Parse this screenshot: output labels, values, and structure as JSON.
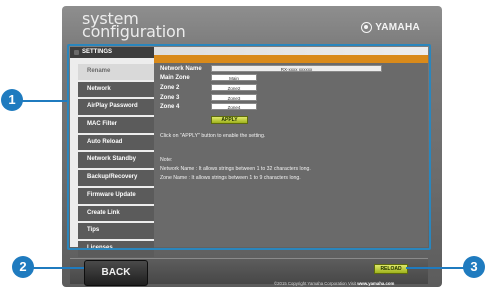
{
  "brand": {
    "title_line1": "system",
    "title_line2": "configuration",
    "logo_text": "YAMAHA"
  },
  "settings": {
    "tab_label": "SETTINGS",
    "sidebar": [
      {
        "label": "Rename"
      },
      {
        "label": "Network"
      },
      {
        "label": "AirPlay Password"
      },
      {
        "label": "MAC Filter"
      },
      {
        "label": "Auto Reload"
      },
      {
        "label": "Network Standby"
      },
      {
        "label": "Backup/Recovery"
      },
      {
        "label": "Firmware Update"
      },
      {
        "label": "Create Link"
      },
      {
        "label": "Tips"
      },
      {
        "label": "Licenses"
      }
    ],
    "active_item": "Rename",
    "form": {
      "network_name_label": "Network Name",
      "network_name_value": "RX-xxxx xxxxxx",
      "main_zone_label": "Main Zone",
      "main_zone_value": "Main",
      "zone2_label": "Zone 2",
      "zone2_value": "Zone2",
      "zone3_label": "Zone 3",
      "zone3_value": "Zone3",
      "zone4_label": "Zone 4",
      "zone4_value": "Zone4",
      "apply_label": "APPLY"
    },
    "instruction": "Click on \"APPLY\" button to enable the setting.",
    "note_title": "Note:",
    "note_network": "Network Name : It allows strings between 1 to 32 characters long.",
    "note_zone": "Zone Name : It allows strings between 1 to 9 characters long."
  },
  "footer": {
    "back_label": "BACK",
    "reload_label": "RELOAD",
    "copyright_prefix": "©2015 Copyright Yamaha Corporation Visit ",
    "copyright_link": "www.yamaha.com"
  },
  "callouts": {
    "c1": "1",
    "c2": "2",
    "c3": "3"
  },
  "colors": {
    "accent_orange": "#d98a1a",
    "callout_blue": "#1f7bbf",
    "button_green": "#b6c935"
  }
}
